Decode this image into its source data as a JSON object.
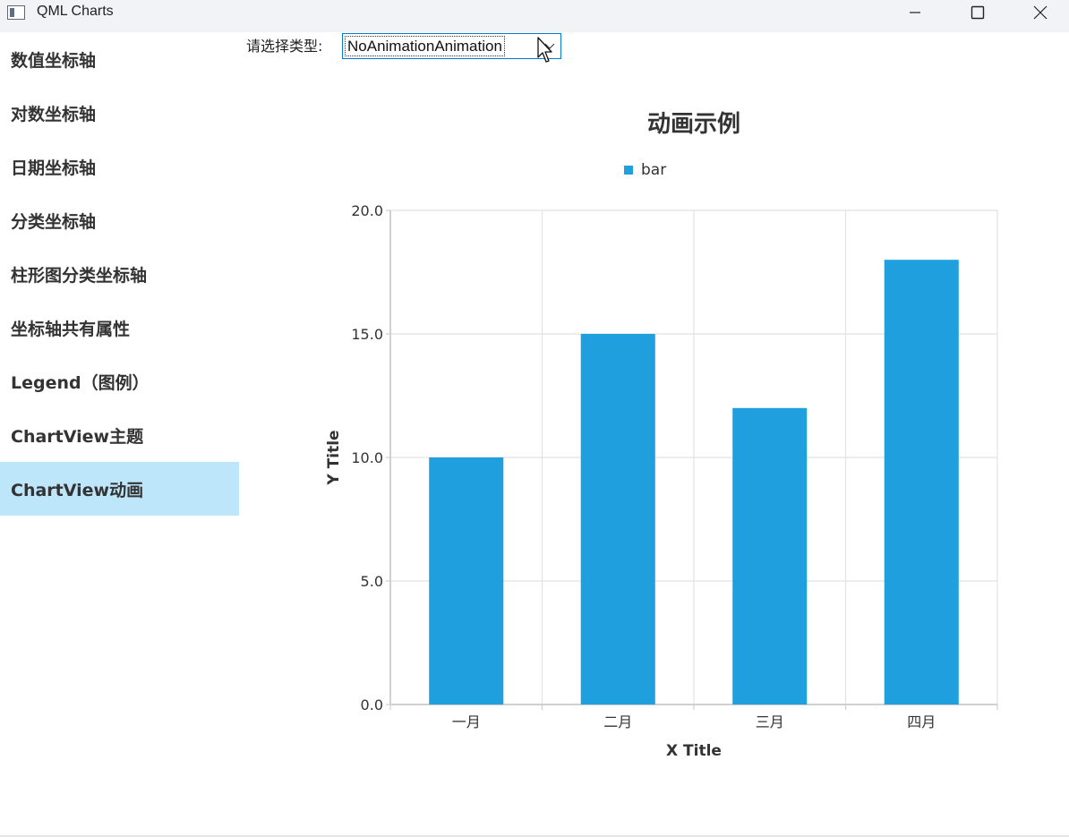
{
  "window": {
    "title": "QML Charts",
    "icon": "app-window-icon",
    "controls": [
      "minimize-icon",
      "maximize-icon",
      "close-icon"
    ]
  },
  "sidebar": {
    "items": [
      {
        "label": "数值坐标轴",
        "active": false
      },
      {
        "label": "对数坐标轴",
        "active": false
      },
      {
        "label": "日期坐标轴",
        "active": false
      },
      {
        "label": "分类坐标轴",
        "active": false
      },
      {
        "label": "柱形图分类坐标轴",
        "active": false
      },
      {
        "label": "坐标轴共有属性",
        "active": false
      },
      {
        "label": "Legend（图例）",
        "active": false
      },
      {
        "label": "ChartView主题",
        "active": false
      },
      {
        "label": "ChartView动画",
        "active": true
      }
    ],
    "active_color": "#bde6fb"
  },
  "selector": {
    "label": "请选择类型:",
    "value": "NoAnimationAnimation"
  },
  "chart_data": {
    "type": "bar",
    "title": "动画示例",
    "categories": [
      "一月",
      "二月",
      "三月",
      "四月"
    ],
    "series": [
      {
        "name": "bar",
        "values": [
          10,
          15,
          12,
          18
        ],
        "color": "#1f9fdd"
      }
    ],
    "xlabel": "X Title",
    "ylabel": "Y Title",
    "ylim": [
      0,
      20
    ],
    "yticks": [
      "0.0",
      "5.0",
      "10.0",
      "15.0",
      "20.0"
    ],
    "grid": true,
    "legend": "top-center"
  }
}
